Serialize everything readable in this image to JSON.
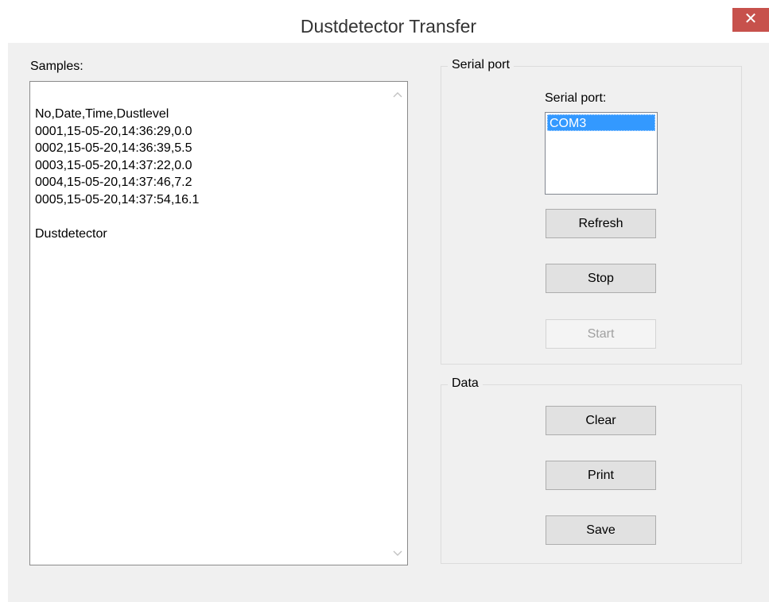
{
  "window": {
    "title": "Dustdetector Transfer",
    "close_glyph": "✕"
  },
  "samples": {
    "label": "Samples:",
    "text": "No,Date,Time,Dustlevel\n0001,15-05-20,14:36:29,0.0\n0002,15-05-20,14:36:39,5.5\n0003,15-05-20,14:37:22,0.0\n0004,15-05-20,14:37:46,7.2\n0005,15-05-20,14:37:54,16.1\n\nDustdetector",
    "scroll_up_glyph": "^",
    "scroll_down_glyph": "v"
  },
  "serial_group": {
    "legend": "Serial port",
    "list_label": "Serial port:",
    "ports": [
      "COM3"
    ],
    "selected_port": "COM3",
    "refresh_label": "Refresh",
    "stop_label": "Stop",
    "start_label": "Start",
    "start_enabled": false
  },
  "data_group": {
    "legend": "Data",
    "clear_label": "Clear",
    "print_label": "Print",
    "save_label": "Save"
  },
  "colors": {
    "close_button": "#c7514c",
    "selection": "#3399ff",
    "window_background": "#f0f0f0"
  },
  "icons": {
    "close": "close-icon",
    "scroll_up": "chevron-up-icon",
    "scroll_down": "chevron-down-icon"
  }
}
